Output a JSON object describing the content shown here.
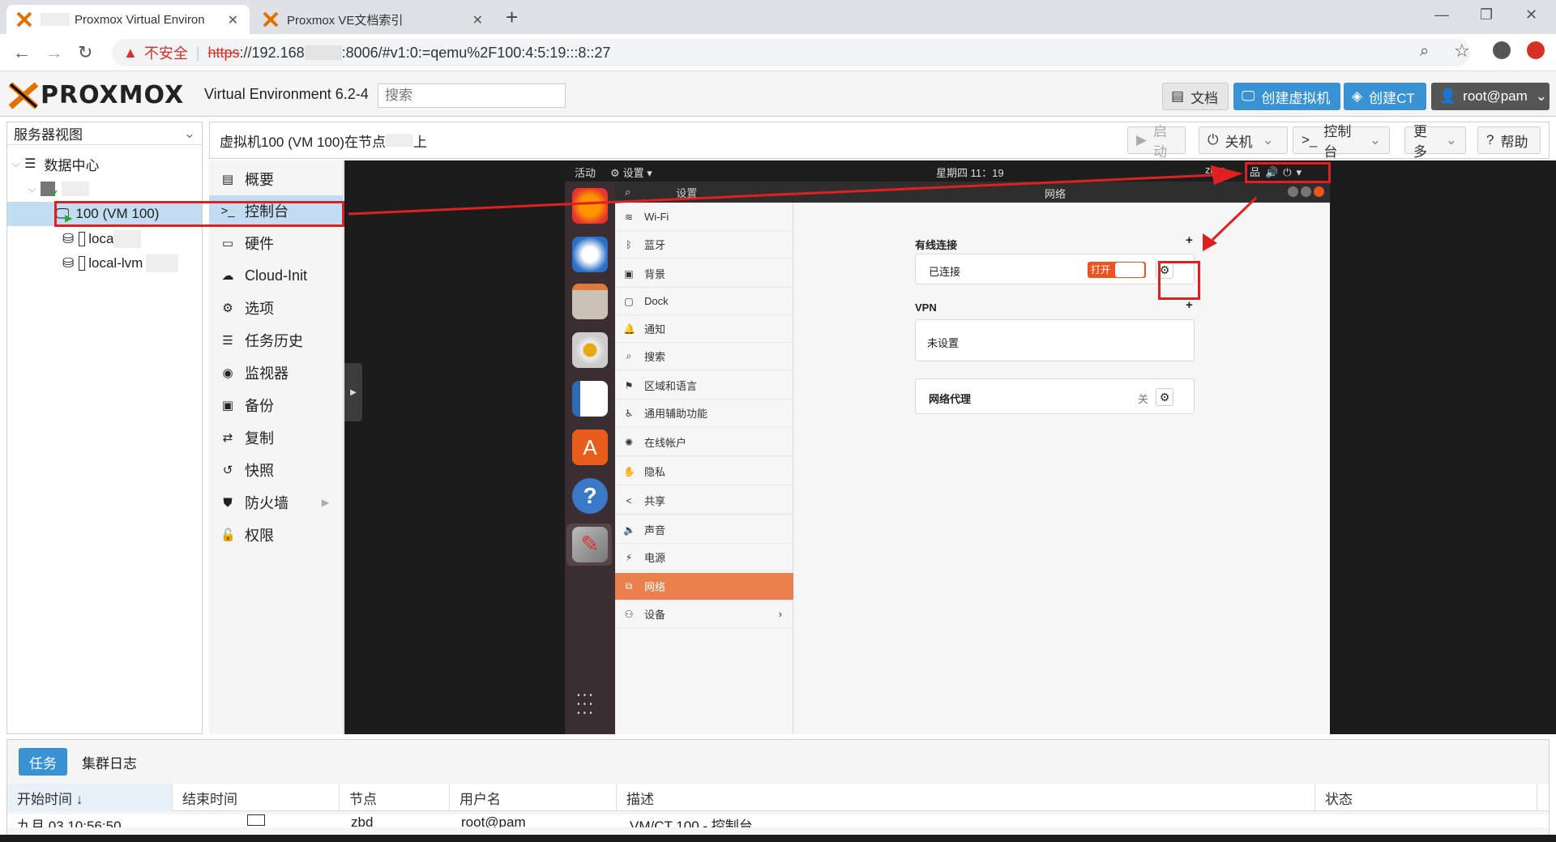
{
  "browser": {
    "tabs": [
      {
        "title": "Proxmox Virtual Environ",
        "active": true
      },
      {
        "title": "Proxmox VE文档索引",
        "active": false
      }
    ],
    "new_tab": "+",
    "security_label": "不安全",
    "url_scheme": "https",
    "url_rest": "://192.168",
    "url_tail": ":8006/#v1:0:=qemu%2F100:4:5:19:::8::27"
  },
  "header": {
    "logo": "PROXMOX",
    "version": "Virtual Environment 6.2-4",
    "search_placeholder": "搜索",
    "buttons": {
      "docs": "文档",
      "create_vm": "创建虚拟机",
      "create_ct": "创建CT",
      "user": "root@pam"
    }
  },
  "tree": {
    "view_select": "服务器视图",
    "datacenter": "数据中心",
    "vm": "100 (VM 100)",
    "storage1": "loca",
    "storage2": "local-lvm"
  },
  "content": {
    "title_prefix": "虚拟机100 (VM 100)在节点",
    "title_suffix": "上",
    "toolbar": {
      "start": "启动",
      "shutdown": "关机",
      "console": "控制台",
      "more": "更多",
      "help": "帮助"
    }
  },
  "vm_nav": [
    {
      "icon": "book",
      "label": "概要"
    },
    {
      "icon": "terminal",
      "label": "控制台",
      "selected": true
    },
    {
      "icon": "monitor",
      "label": "硬件"
    },
    {
      "icon": "cloud",
      "label": "Cloud-Init"
    },
    {
      "icon": "gear",
      "label": "选项"
    },
    {
      "icon": "list",
      "label": "任务历史"
    },
    {
      "icon": "eye",
      "label": "监视器"
    },
    {
      "icon": "save",
      "label": "备份"
    },
    {
      "icon": "retweet",
      "label": "复制"
    },
    {
      "icon": "history",
      "label": "快照"
    },
    {
      "icon": "shield",
      "label": "防火墙"
    },
    {
      "icon": "unlock",
      "label": "权限"
    }
  ],
  "ubuntu": {
    "activities": "活动",
    "app_menu": "设置",
    "clock": "星期四 11：19",
    "sidebar_title": "设置",
    "window_title": "网络",
    "sidebar": [
      {
        "icon": "wifi",
        "label": "Wi-Fi"
      },
      {
        "icon": "bluetooth",
        "label": "蓝牙"
      },
      {
        "icon": "background",
        "label": "背景"
      },
      {
        "icon": "dock",
        "label": "Dock"
      },
      {
        "icon": "bell",
        "label": "通知"
      },
      {
        "icon": "search",
        "label": "搜索"
      },
      {
        "icon": "flag",
        "label": "区域和语言"
      },
      {
        "icon": "accessibility",
        "label": "通用辅助功能"
      },
      {
        "icon": "accounts",
        "label": "在线帐户"
      },
      {
        "icon": "hand",
        "label": "隐私"
      },
      {
        "icon": "share",
        "label": "共享"
      },
      {
        "icon": "speaker",
        "label": "声音"
      },
      {
        "icon": "power",
        "label": "电源"
      },
      {
        "icon": "network",
        "label": "网络",
        "selected": true
      },
      {
        "icon": "devices",
        "label": "设备"
      }
    ],
    "wired": {
      "heading": "有线连接",
      "status": "已连接",
      "switch": "打开"
    },
    "vpn": {
      "heading": "VPN",
      "status": "未设置"
    },
    "proxy": {
      "label": "网络代理",
      "value": "关"
    },
    "add": "+"
  },
  "bottom": {
    "tabs": [
      "任务",
      "集群日志"
    ],
    "columns": [
      "开始时间 ↓",
      "结束时间",
      "节点",
      "用户名",
      "描述",
      "状态"
    ],
    "row": [
      "九月 03 10:56:50",
      "",
      "zbd",
      "root@pam",
      "VM/CT 100 - 控制台",
      ""
    ]
  }
}
